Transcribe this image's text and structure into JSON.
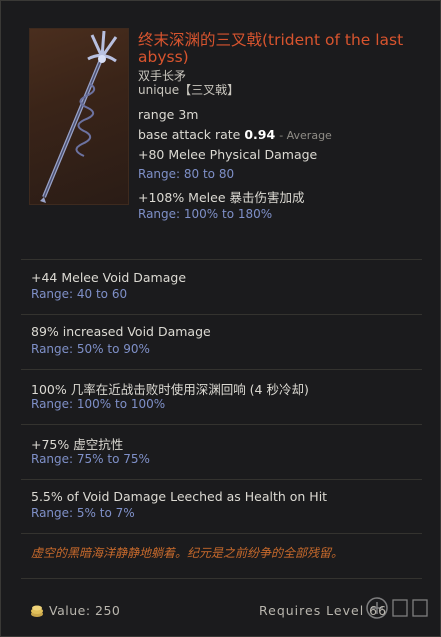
{
  "item": {
    "title": "终末深渊的三叉戟(trident of the last abyss)",
    "subtype": "双手长矛",
    "rarity": "unique【三叉戟】",
    "range": "range 3m",
    "attack_rate_label": "base attack rate",
    "attack_rate_value": "0.94",
    "attack_rate_note": "- Average",
    "implicit1": "+80 Melee Physical Damage",
    "implicit1_range": "Range: 80 to 80",
    "implicit2": "+108% Melee 暴击伤害加成",
    "implicit2_range": "Range: 100% to 180%"
  },
  "affixes": [
    {
      "text": "+44 Melee Void Damage",
      "range": "Range: 40 to 60"
    },
    {
      "text": "89% increased Void Damage",
      "range": "Range: 50% to 90%"
    },
    {
      "text": "100% 几率在近战击败时使用深渊回响 (4 秒冷却)",
      "range": "Range: 100% to 100%"
    },
    {
      "text": "+75% 虚空抗性",
      "range": "Range: 75% to 75%"
    },
    {
      "text": "5.5% of Void Damage Leeched as Health on Hit",
      "range": "Range: 5% to 7%"
    }
  ],
  "lore": "虚空的黑暗海洋静静地躺着。纪元是之前纷争的全部残留。",
  "footer": {
    "value": "Value: 250",
    "requires": "Requires Level 66"
  },
  "icons": [
    "trident-art",
    "coin-icon",
    "watermark-logo"
  ],
  "colors": {
    "title": "#d8542e",
    "range": "#7f90c8",
    "lore": "#c86a2c",
    "background": "#1b1b1d"
  }
}
